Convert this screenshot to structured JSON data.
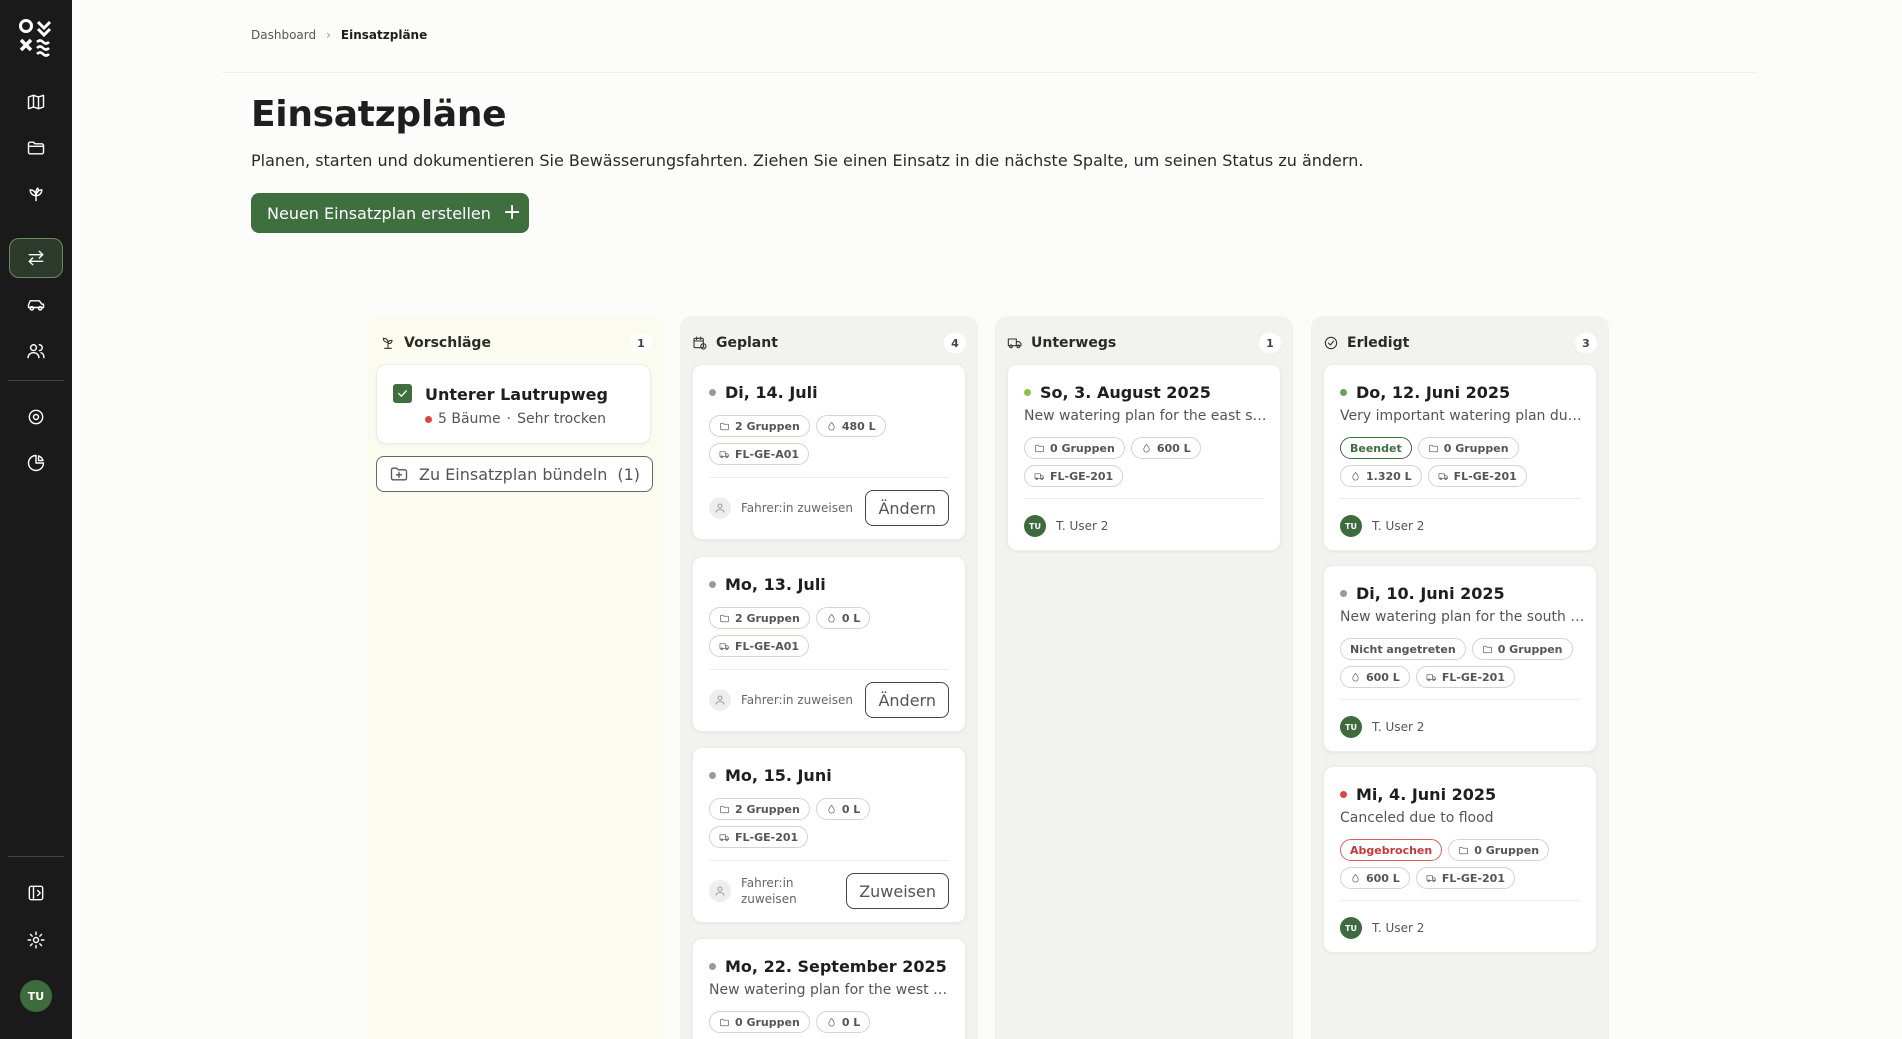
{
  "breadcrumb": {
    "root": "Dashboard",
    "current": "Einsatzpläne"
  },
  "header": {
    "title": "Einsatzpläne",
    "description": "Planen, starten und dokumentieren Sie Bewässerungsfahrten. Ziehen Sie einen Einsatz in die nächste Spalte, um seinen Status zu ändern.",
    "create_label": "Neuen Einsatzplan erstellen"
  },
  "sidebar": {
    "avatar": "TU"
  },
  "columns": {
    "vorschlaege": {
      "title": "Vorschläge",
      "count": "1"
    },
    "geplant": {
      "title": "Geplant",
      "count": "4"
    },
    "unterwegs": {
      "title": "Unterwegs",
      "count": "1"
    },
    "erledigt": {
      "title": "Erledigt",
      "count": "3"
    }
  },
  "suggestion": {
    "title": "Unterer Lautrupweg",
    "trees": "5 Bäume",
    "separator": "·",
    "condition": "Sehr trocken",
    "bundle_label": "Zu Einsatzplan bündeln",
    "bundle_count": "(1)"
  },
  "geplant_cards": [
    {
      "date": "Di, 14. Juli",
      "groups": "2 Gruppen",
      "water": "480 L",
      "vehicle": "FL-GE-A01",
      "assign": "Fahrer:in zuweisen",
      "action": "Ändern"
    },
    {
      "date": "Mo, 13. Juli",
      "groups": "2 Gruppen",
      "water": "0 L",
      "vehicle": "FL-GE-A01",
      "assign": "Fahrer:in zuweisen",
      "action": "Ändern"
    },
    {
      "date": "Mo, 15. Juni",
      "groups": "2 Gruppen",
      "water": "0 L",
      "vehicle": "FL-GE-201",
      "assign_l1": "Fahrer:in",
      "assign_l2": "zuweisen",
      "action": "Zuweisen"
    },
    {
      "date": "Mo, 22. September 2025",
      "desc": "New watering plan for the west side of the city",
      "groups": "0 Gruppen",
      "water": "0 L"
    }
  ],
  "unterwegs_cards": [
    {
      "date": "So, 3. August 2025",
      "desc": "New watering plan for the east side of the city",
      "groups": "0 Gruppen",
      "water": "600 L",
      "vehicle": "FL-GE-201",
      "avatar": "TU",
      "user": "T. User 2"
    }
  ],
  "erledigt_cards": [
    {
      "date": "Do, 12. Juni 2025",
      "desc": "Very important watering plan due to no rainfall",
      "status": "Beendet",
      "groups": "0 Gruppen",
      "water": "1.320 L",
      "vehicle": "FL-GE-201",
      "avatar": "TU",
      "user": "T. User 2"
    },
    {
      "date": "Di, 10. Juni 2025",
      "desc": "New watering plan for the south side of the city",
      "status": "Nicht angetreten",
      "groups": "0 Gruppen",
      "water": "600 L",
      "vehicle": "FL-GE-201",
      "avatar": "TU",
      "user": "T. User 2"
    },
    {
      "date": "Mi, 4. Juni 2025",
      "desc": "Canceled due to flood",
      "status": "Abgebrochen",
      "groups": "0 Gruppen",
      "water": "600 L",
      "vehicle": "FL-GE-201",
      "avatar": "TU",
      "user": "T. User 2"
    }
  ],
  "colors": {
    "primary": "#3f6e3f",
    "sidebar": "#1a1a1a",
    "dot_planned": "#9a9a9a",
    "dot_active": "#8fbf4a",
    "dot_done": "#6fa05a",
    "dot_cancelled": "#d94444",
    "col_suggest_bg": "#fbfbf0",
    "col_bg": "#f2f2ef"
  }
}
